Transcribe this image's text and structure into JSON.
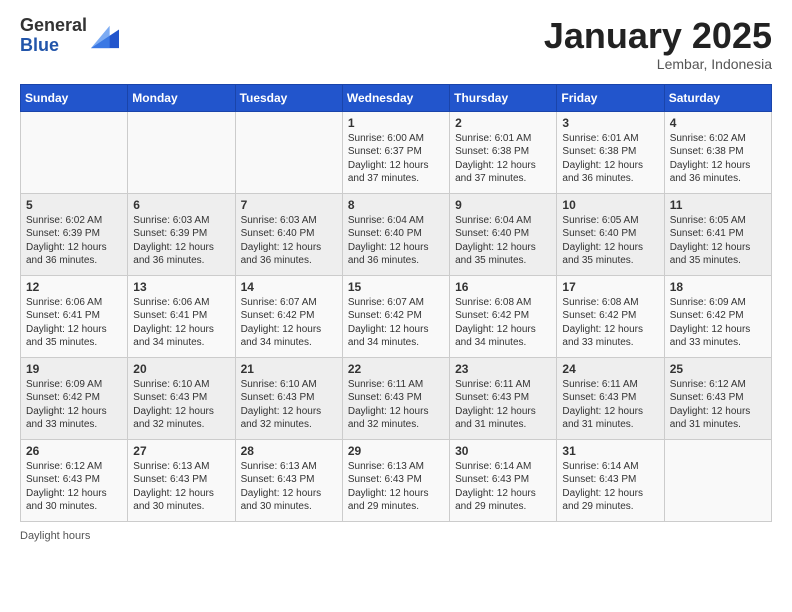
{
  "header": {
    "logo_general": "General",
    "logo_blue": "Blue",
    "month_title": "January 2025",
    "subtitle": "Lembar, Indonesia"
  },
  "days_of_week": [
    "Sunday",
    "Monday",
    "Tuesday",
    "Wednesday",
    "Thursday",
    "Friday",
    "Saturday"
  ],
  "weeks": [
    [
      {
        "num": "",
        "info": ""
      },
      {
        "num": "",
        "info": ""
      },
      {
        "num": "",
        "info": ""
      },
      {
        "num": "1",
        "info": "Sunrise: 6:00 AM\nSunset: 6:37 PM\nDaylight: 12 hours and 37 minutes."
      },
      {
        "num": "2",
        "info": "Sunrise: 6:01 AM\nSunset: 6:38 PM\nDaylight: 12 hours and 37 minutes."
      },
      {
        "num": "3",
        "info": "Sunrise: 6:01 AM\nSunset: 6:38 PM\nDaylight: 12 hours and 36 minutes."
      },
      {
        "num": "4",
        "info": "Sunrise: 6:02 AM\nSunset: 6:38 PM\nDaylight: 12 hours and 36 minutes."
      }
    ],
    [
      {
        "num": "5",
        "info": "Sunrise: 6:02 AM\nSunset: 6:39 PM\nDaylight: 12 hours and 36 minutes."
      },
      {
        "num": "6",
        "info": "Sunrise: 6:03 AM\nSunset: 6:39 PM\nDaylight: 12 hours and 36 minutes."
      },
      {
        "num": "7",
        "info": "Sunrise: 6:03 AM\nSunset: 6:40 PM\nDaylight: 12 hours and 36 minutes."
      },
      {
        "num": "8",
        "info": "Sunrise: 6:04 AM\nSunset: 6:40 PM\nDaylight: 12 hours and 36 minutes."
      },
      {
        "num": "9",
        "info": "Sunrise: 6:04 AM\nSunset: 6:40 PM\nDaylight: 12 hours and 35 minutes."
      },
      {
        "num": "10",
        "info": "Sunrise: 6:05 AM\nSunset: 6:40 PM\nDaylight: 12 hours and 35 minutes."
      },
      {
        "num": "11",
        "info": "Sunrise: 6:05 AM\nSunset: 6:41 PM\nDaylight: 12 hours and 35 minutes."
      }
    ],
    [
      {
        "num": "12",
        "info": "Sunrise: 6:06 AM\nSunset: 6:41 PM\nDaylight: 12 hours and 35 minutes."
      },
      {
        "num": "13",
        "info": "Sunrise: 6:06 AM\nSunset: 6:41 PM\nDaylight: 12 hours and 34 minutes."
      },
      {
        "num": "14",
        "info": "Sunrise: 6:07 AM\nSunset: 6:42 PM\nDaylight: 12 hours and 34 minutes."
      },
      {
        "num": "15",
        "info": "Sunrise: 6:07 AM\nSunset: 6:42 PM\nDaylight: 12 hours and 34 minutes."
      },
      {
        "num": "16",
        "info": "Sunrise: 6:08 AM\nSunset: 6:42 PM\nDaylight: 12 hours and 34 minutes."
      },
      {
        "num": "17",
        "info": "Sunrise: 6:08 AM\nSunset: 6:42 PM\nDaylight: 12 hours and 33 minutes."
      },
      {
        "num": "18",
        "info": "Sunrise: 6:09 AM\nSunset: 6:42 PM\nDaylight: 12 hours and 33 minutes."
      }
    ],
    [
      {
        "num": "19",
        "info": "Sunrise: 6:09 AM\nSunset: 6:42 PM\nDaylight: 12 hours and 33 minutes."
      },
      {
        "num": "20",
        "info": "Sunrise: 6:10 AM\nSunset: 6:43 PM\nDaylight: 12 hours and 32 minutes."
      },
      {
        "num": "21",
        "info": "Sunrise: 6:10 AM\nSunset: 6:43 PM\nDaylight: 12 hours and 32 minutes."
      },
      {
        "num": "22",
        "info": "Sunrise: 6:11 AM\nSunset: 6:43 PM\nDaylight: 12 hours and 32 minutes."
      },
      {
        "num": "23",
        "info": "Sunrise: 6:11 AM\nSunset: 6:43 PM\nDaylight: 12 hours and 31 minutes."
      },
      {
        "num": "24",
        "info": "Sunrise: 6:11 AM\nSunset: 6:43 PM\nDaylight: 12 hours and 31 minutes."
      },
      {
        "num": "25",
        "info": "Sunrise: 6:12 AM\nSunset: 6:43 PM\nDaylight: 12 hours and 31 minutes."
      }
    ],
    [
      {
        "num": "26",
        "info": "Sunrise: 6:12 AM\nSunset: 6:43 PM\nDaylight: 12 hours and 30 minutes."
      },
      {
        "num": "27",
        "info": "Sunrise: 6:13 AM\nSunset: 6:43 PM\nDaylight: 12 hours and 30 minutes."
      },
      {
        "num": "28",
        "info": "Sunrise: 6:13 AM\nSunset: 6:43 PM\nDaylight: 12 hours and 30 minutes."
      },
      {
        "num": "29",
        "info": "Sunrise: 6:13 AM\nSunset: 6:43 PM\nDaylight: 12 hours and 29 minutes."
      },
      {
        "num": "30",
        "info": "Sunrise: 6:14 AM\nSunset: 6:43 PM\nDaylight: 12 hours and 29 minutes."
      },
      {
        "num": "31",
        "info": "Sunrise: 6:14 AM\nSunset: 6:43 PM\nDaylight: 12 hours and 29 minutes."
      },
      {
        "num": "",
        "info": ""
      }
    ]
  ],
  "footer": {
    "daylight_label": "Daylight hours"
  }
}
